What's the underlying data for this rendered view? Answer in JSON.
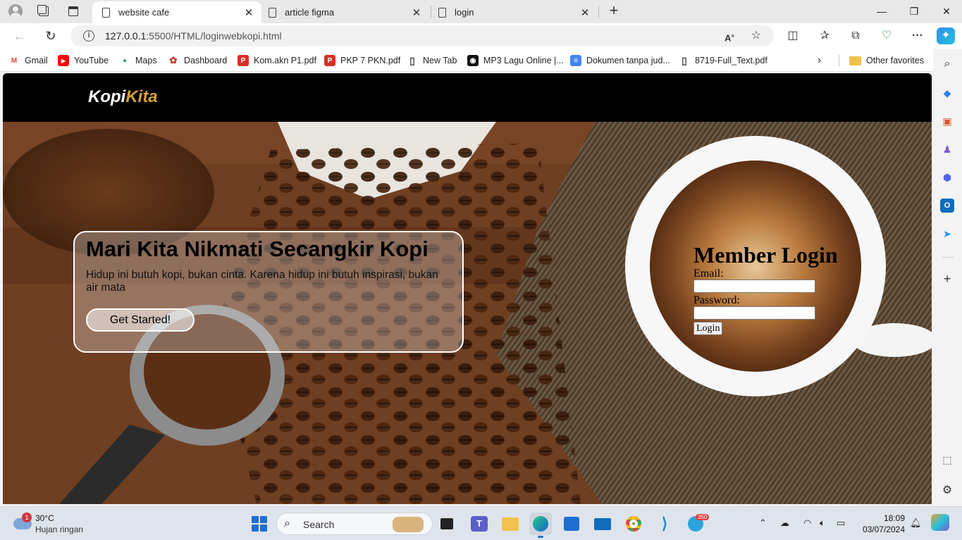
{
  "browser": {
    "tabs": [
      {
        "label": "website cafe",
        "active": true
      },
      {
        "label": "article figma",
        "active": false
      },
      {
        "label": "login",
        "active": false
      }
    ],
    "close_glyph": "✕",
    "newtab_glyph": "+",
    "window_controls": {
      "minimize": "—",
      "restore": "❐",
      "close": "✕"
    },
    "url_host": "127.0.0.1",
    "url_rest": ":5500/HTML/loginwebkopi.html",
    "info_glyph": "i",
    "favorites": [
      {
        "label": "Gmail",
        "icon": "gmail-icon",
        "color": "#ea4335",
        "glyph": "M"
      },
      {
        "label": "YouTube",
        "icon": "youtube-icon",
        "color": "#ff0000",
        "glyph": "▶"
      },
      {
        "label": "Maps",
        "icon": "maps-icon",
        "color": "#34a853",
        "glyph": "●"
      },
      {
        "label": "Dashboard",
        "icon": "dashboard-icon",
        "color": "#c0392b",
        "glyph": "✿"
      },
      {
        "label": "Kom.akn P1.pdf",
        "icon": "pdf-icon",
        "color": "#d93025",
        "glyph": "P"
      },
      {
        "label": "PKP 7 PKN.pdf",
        "icon": "pdf-icon",
        "color": "#d93025",
        "glyph": "P"
      },
      {
        "label": "New Tab",
        "icon": "page-icon",
        "color": "#ffffff",
        "glyph": "▯"
      },
      {
        "label": "MP3 Lagu Online |...",
        "icon": "music-icon",
        "color": "#111111",
        "glyph": "◉"
      },
      {
        "label": "Dokumen tanpa jud...",
        "icon": "docs-icon",
        "color": "#4285f4",
        "glyph": "≡"
      },
      {
        "label": "8719-Full_Text.pdf",
        "icon": "page-icon",
        "color": "#ffffff",
        "glyph": "▯"
      }
    ],
    "other_favorites": "Other favorites"
  },
  "site": {
    "logo_part1": "Kopi",
    "logo_part2": "Kita",
    "accent_color": "#d4a037",
    "hero_title": "Mari Kita Nikmati Secangkir Kopi",
    "hero_text": "Hidup ini butuh kopi, bukan cinta. Karena hidup ini butuh inspirasi, bukan air mata",
    "cta_label": "Get Started!",
    "login": {
      "title": "Member Login",
      "email_label": "Email:",
      "password_label": "Password:",
      "button_label": "Login"
    }
  },
  "taskbar": {
    "weather_badge": "1",
    "temperature": "30°C",
    "weather_desc": "Hujan ringan",
    "search_label": "Search",
    "time": "18:09",
    "date": "03/07/2024",
    "telegram_badge": "350"
  }
}
